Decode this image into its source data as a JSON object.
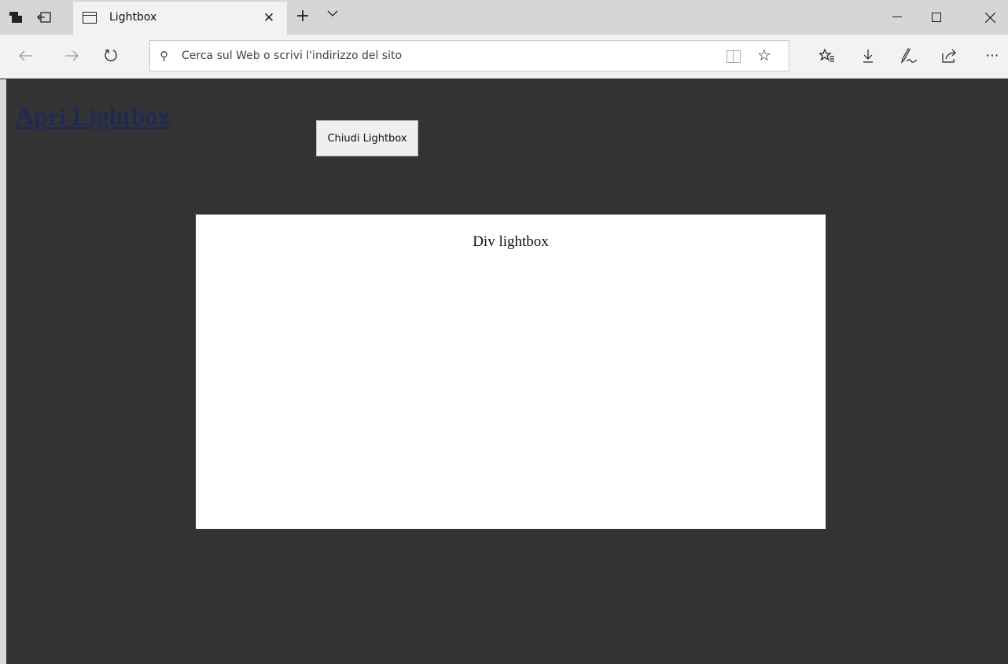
{
  "browser": {
    "tab": {
      "title": "Lightbox"
    },
    "address_bar": {
      "placeholder": "Cerca sul Web o scrivi l'indirizzo del sito"
    },
    "icons": {
      "tab_actions": "tab-actions-icon",
      "set_aside": "set-aside-tabs-icon",
      "page": "page-icon",
      "close_tab": "close-icon",
      "new_tab": "plus-icon",
      "tab_menu": "chevron-down-icon",
      "back": "arrow-left-icon",
      "forward": "arrow-right-icon",
      "refresh": "refresh-icon",
      "search": "search-icon",
      "reading_view": "book-icon",
      "favorite": "star-icon",
      "favorites_hub": "favorites-list-icon",
      "downloads": "download-icon",
      "notes": "pen-icon",
      "share": "share-icon",
      "more": "more-icon",
      "minimize": "minimize-icon",
      "maximize": "maximize-icon",
      "close_window": "close-window-icon"
    }
  },
  "page": {
    "background": "#333333",
    "open_link": "Apri Lightbox",
    "close_button": "Chiudi Lightbox",
    "lightbox": {
      "text": "Div lightbox",
      "background": "#ffffff"
    }
  }
}
